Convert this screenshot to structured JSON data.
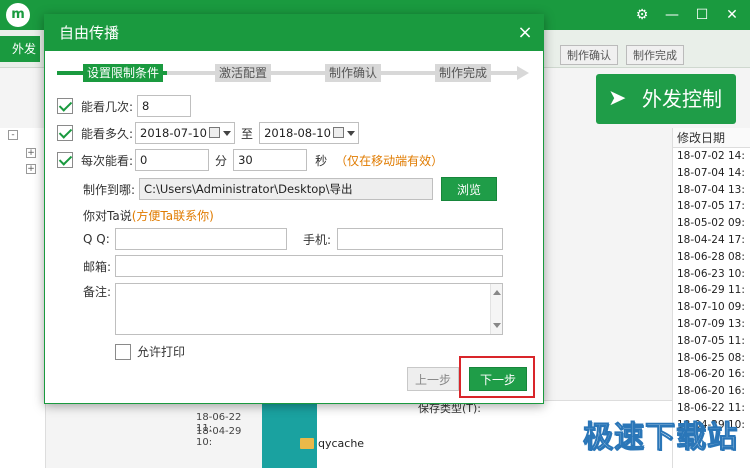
{
  "app": {
    "nav_tab": "外发",
    "steps": [
      "制作确认",
      "制作完成"
    ],
    "big_button": "外发控制",
    "list_header": "修改日期",
    "dates": [
      "18-07-02 14:",
      "18-07-04 14:",
      "18-07-04 13:",
      "18-07-05 17:",
      "18-05-02 09:",
      "18-04-24 17:",
      "18-06-28 08:",
      "18-06-23 10:",
      "18-06-29 11:",
      "18-07-10 09:",
      "18-07-09 13:",
      "18-07-05 11:",
      "18-06-25 08:",
      "18-06-20 16:",
      "18-06-20 16:",
      "18-06-22 11:",
      "18-04-29 10:"
    ],
    "lower_dates": [
      "18-06-22 11:",
      "18-04-29 10:"
    ],
    "folder": "qycache",
    "save_type": "保存类型(T):",
    "watermark": "极速下载站"
  },
  "dialog": {
    "title": "自由传播",
    "close": "×",
    "steps": [
      "设置限制条件",
      "激活配置",
      "制作确认",
      "制作完成"
    ],
    "view_count_label": "能看几次:",
    "view_count_value": "8",
    "view_duration_label": "能看多久:",
    "date_from": "2018-07-10",
    "date_to_label": "至",
    "date_to": "2018-08-10",
    "each_view_label": "每次能看:",
    "minutes_value": "0",
    "minutes_unit": "分",
    "seconds_value": "30",
    "seconds_unit": "秒",
    "mobile_note": "（仅在移动端有效）",
    "output_label": "制作到哪:",
    "output_path": "C:\\Users\\Administrator\\Desktop\\导出",
    "browse": "浏览",
    "message_label": "你对Ta说",
    "message_hint": "(方便Ta联系你)",
    "qq_label": "Q Q:",
    "qq_value": "",
    "phone_label": "手机:",
    "phone_value": "",
    "email_label": "邮箱:",
    "email_value": "",
    "note_label": "备注:",
    "note_value": "",
    "allow_print": "允许打印",
    "prev": "上一步",
    "next": "下一步"
  },
  "colors": {
    "accent": "#1a9a3f",
    "highlight": "#d9252a",
    "note_orange": "#e07b00"
  },
  "icons": [
    "app-logo-icon",
    "gear-icon",
    "minimize-icon",
    "maximize-icon",
    "close-icon",
    "calendar-icon",
    "checkbox-icon",
    "folder-icon",
    "paper-plane-icon"
  ]
}
